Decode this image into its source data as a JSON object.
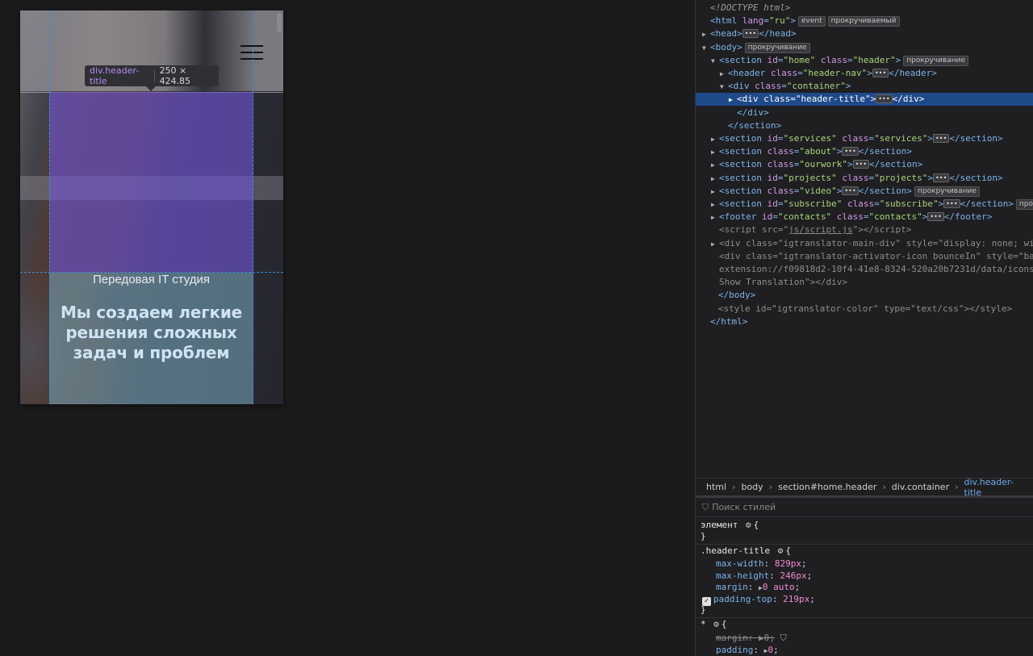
{
  "tooltip": {
    "selector": "div.header-title",
    "dimensions": "250 × 424.85"
  },
  "hero": {
    "subtitle": "Передовая IT студия",
    "headline": "Мы создаем легкие решения сложных задач и проблем"
  },
  "dom": [
    {
      "indent": 0,
      "html": "<span class='italic'>&lt;!DOCTYPE html&gt;</span>"
    },
    {
      "indent": 0,
      "html": "<span class='tag'>&lt;html</span> <span class='attr'>lang</span><span class='punct'>=</span><span class='val'>\"ru\"</span><span class='tag'>&gt;</span><span class='badge'>event</span><span class='badge'>прокручиваемый</span>"
    },
    {
      "indent": 0,
      "tri": "▶",
      "html": "<span class='tag'>&lt;head&gt;</span><span class='dots'>•••</span><span class='tag'>&lt;/head&gt;</span>"
    },
    {
      "indent": 0,
      "tri": "▼",
      "html": "<span class='tag'>&lt;body&gt;</span><span class='badge'>прокручивание</span>"
    },
    {
      "indent": 1,
      "tri": "▼",
      "html": "<span class='tag'>&lt;section</span> <span class='attr'>id</span><span class='punct'>=</span><span class='val'>\"home\"</span> <span class='attr'>class</span><span class='punct'>=</span><span class='val'>\"header\"</span><span class='tag'>&gt;</span><span class='badge'>прокручивание</span>"
    },
    {
      "indent": 2,
      "tri": "▶",
      "html": "<span class='tag'>&lt;header</span> <span class='attr'>class</span><span class='punct'>=</span><span class='val'>\"header-nav\"</span><span class='tag'>&gt;</span><span class='dots'>•••</span><span class='tag'>&lt;/header&gt;</span>"
    },
    {
      "indent": 2,
      "tri": "▼",
      "html": "<span class='tag'>&lt;div</span> <span class='attr'>class</span><span class='punct'>=</span><span class='val'>\"container\"</span><span class='tag'>&gt;</span>"
    },
    {
      "indent": 3,
      "tri": "▶",
      "selected": true,
      "html": "<span class='tag' style='color:#fff'>&lt;div</span> <span class='attr' style='color:#fff'>class</span><span style='color:#fff'>=\"header-title\"&gt;</span><span class='dots'>•••</span><span style='color:#fff'>&lt;/div&gt;</span>"
    },
    {
      "indent": 3,
      "html": "<span class='tag'>&lt;/div&gt;</span>"
    },
    {
      "indent": 2,
      "html": "<span class='tag'>&lt;/section&gt;</span>"
    },
    {
      "indent": 1,
      "tri": "▶",
      "html": "<span class='tag'>&lt;section</span> <span class='attr'>id</span><span class='punct'>=</span><span class='val'>\"services\"</span> <span class='attr'>class</span><span class='punct'>=</span><span class='val'>\"services\"</span><span class='tag'>&gt;</span><span class='dots'>•••</span><span class='tag'>&lt;/section&gt;</span>"
    },
    {
      "indent": 1,
      "tri": "▶",
      "html": "<span class='tag'>&lt;section</span> <span class='attr'>class</span><span class='punct'>=</span><span class='val'>\"about\"</span><span class='tag'>&gt;</span><span class='dots'>•••</span><span class='tag'>&lt;/section&gt;</span>"
    },
    {
      "indent": 1,
      "tri": "▶",
      "html": "<span class='tag'>&lt;section</span> <span class='attr'>class</span><span class='punct'>=</span><span class='val'>\"ourwork\"</span><span class='tag'>&gt;</span><span class='dots'>•••</span><span class='tag'>&lt;/section&gt;</span>"
    },
    {
      "indent": 1,
      "tri": "▶",
      "html": "<span class='tag'>&lt;section</span> <span class='attr'>id</span><span class='punct'>=</span><span class='val'>\"projects\"</span> <span class='attr'>class</span><span class='punct'>=</span><span class='val'>\"projects\"</span><span class='tag'>&gt;</span><span class='dots'>•••</span><span class='tag'>&lt;/section&gt;</span>"
    },
    {
      "indent": 1,
      "tri": "▶",
      "html": "<span class='tag'>&lt;section</span> <span class='attr'>class</span><span class='punct'>=</span><span class='val'>\"video\"</span><span class='tag'>&gt;</span><span class='dots'>•••</span><span class='tag'>&lt;/section&gt;</span><span class='badge'>прокручивание</span>"
    },
    {
      "indent": 1,
      "tri": "▶",
      "html": "<span class='tag'>&lt;section</span> <span class='attr'>id</span><span class='punct'>=</span><span class='val'>\"subscribe\"</span> <span class='attr'>class</span><span class='punct'>=</span><span class='val'>\"subscribe\"</span><span class='tag'>&gt;</span><span class='dots'>•••</span><span class='tag'>&lt;/section&gt;</span><span class='badge'>прокру</span>"
    },
    {
      "indent": 1,
      "tri": "▶",
      "html": "<span class='tag'>&lt;footer</span> <span class='attr'>id</span><span class='punct'>=</span><span class='val'>\"contacts\"</span> <span class='attr'>class</span><span class='punct'>=</span><span class='val'>\"contacts\"</span><span class='tag'>&gt;</span><span class='dots'>•••</span><span class='tag'>&lt;/footer&gt;</span>"
    },
    {
      "indent": 1,
      "html": "<span class='grey'>&lt;script src=\"<u>js/script.js</u>\"&gt;&lt;/script&gt;</span>"
    },
    {
      "indent": 1,
      "tri": "▶",
      "html": "<span class='grey'>&lt;div class=\"igtranslator-main-div\" style=\"display: none; wi</span>"
    },
    {
      "indent": 1,
      "html": "<span class='grey'>&lt;div class=\"igtranslator-activator-icon bounceIn\" style=\"ba</span>"
    },
    {
      "indent": 1,
      "html": "<span class='grey'>extension://f09818d2-10f4-41e8-8324-520a20b7231d/data/icons</span>"
    },
    {
      "indent": 1,
      "html": "<span class='grey'>Show Translation\"&gt;&lt;/div&gt;</span>"
    },
    {
      "indent": 0.9,
      "html": "<span class='tag'>&lt;/body&gt;</span>"
    },
    {
      "indent": 0.9,
      "html": "<span class='grey'>&lt;style id=\"igtranslator-color\" type=\"text/css\"&gt;&lt;/style&gt;</span>"
    },
    {
      "indent": 0,
      "html": "<span class='tag'>&lt;/html&gt;</span>"
    }
  ],
  "breadcrumb": [
    "html",
    "body",
    "section#home.header",
    "div.container",
    "div.header-title"
  ],
  "styles": {
    "filter_placeholder": "Поиск стилей",
    "element_label": "элемент",
    "header_title_selector": ".header-title",
    "props": [
      {
        "name": "max-width",
        "value": "829px"
      },
      {
        "name": "max-height",
        "value": "246px"
      },
      {
        "name": "margin",
        "value": "0 auto"
      },
      {
        "name": "padding-top",
        "value": "219px"
      }
    ],
    "universal_selector": "*",
    "universal_props": [
      {
        "name": "margin",
        "value": "0"
      },
      {
        "name": "padding",
        "value": "0"
      }
    ]
  }
}
